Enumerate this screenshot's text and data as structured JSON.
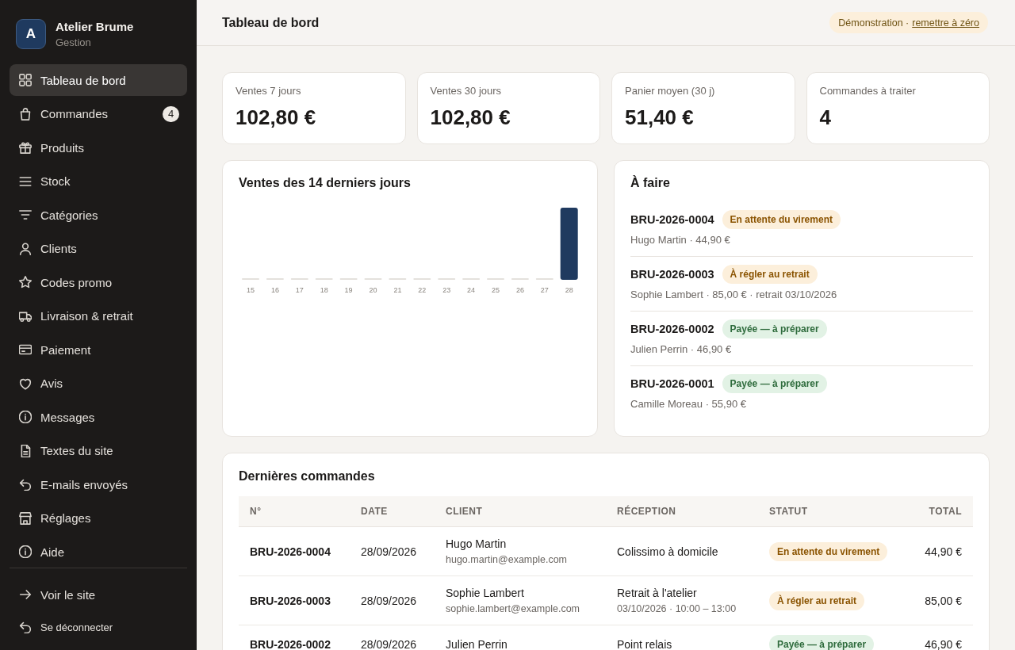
{
  "sidebar": {
    "brand": {
      "logo_letter": "A",
      "name": "Atelier Brume",
      "subtitle": "Gestion"
    },
    "items": [
      {
        "label": "Tableau de bord",
        "selected": true
      },
      {
        "label": "Commandes",
        "selected": false,
        "badge": "4"
      },
      {
        "label": "Produits",
        "selected": false
      },
      {
        "label": "Stock",
        "selected": false
      },
      {
        "label": "Catégories",
        "selected": false
      },
      {
        "label": "Clients",
        "selected": false
      },
      {
        "label": "Codes promo",
        "selected": false
      },
      {
        "label": "Livraison & retrait",
        "selected": false
      },
      {
        "label": "Paiement",
        "selected": false
      },
      {
        "label": "Avis",
        "selected": false
      },
      {
        "label": "Messages",
        "selected": false
      },
      {
        "label": "Textes du site",
        "selected": false
      },
      {
        "label": "E-mails envoyés",
        "selected": false
      },
      {
        "label": "Réglages",
        "selected": false
      },
      {
        "label": "Aide",
        "selected": false
      }
    ],
    "footer_items": [
      {
        "label": "Voir le site",
        "kind": "link"
      },
      {
        "label": "Se déconnecter",
        "kind": "button"
      }
    ]
  },
  "header": {
    "title": "Tableau de bord",
    "demo_notice": {
      "text": "Démonstration ·",
      "link": "remettre à zéro"
    }
  },
  "stats": [
    {
      "label": "Ventes 7 jours",
      "value": "102,80 €"
    },
    {
      "label": "Ventes 30 jours",
      "value": "102,80 €"
    },
    {
      "label": "Panier moyen (30 j)",
      "value": "51,40 €"
    },
    {
      "label": "Commandes à traiter",
      "value": "4"
    }
  ],
  "sales_chart": {
    "title": "Ventes des 14 derniers jours",
    "days": [
      {
        "label": "15",
        "kind": "empty"
      },
      {
        "label": "16",
        "kind": "empty"
      },
      {
        "label": "17",
        "kind": "empty"
      },
      {
        "label": "18",
        "kind": "empty"
      },
      {
        "label": "19",
        "kind": "empty"
      },
      {
        "label": "20",
        "kind": "empty"
      },
      {
        "label": "21",
        "kind": "empty"
      },
      {
        "label": "22",
        "kind": "empty"
      },
      {
        "label": "23",
        "kind": "empty"
      },
      {
        "label": "24",
        "kind": "empty"
      },
      {
        "label": "25",
        "kind": "empty"
      },
      {
        "label": "26",
        "kind": "empty"
      },
      {
        "label": "27",
        "kind": "empty"
      },
      {
        "label": "28",
        "kind": "sale"
      }
    ]
  },
  "todo": {
    "title": "À faire",
    "items": [
      {
        "order": "BRU-2026-0004",
        "status": {
          "label": "En attente du virement",
          "kind": "warning"
        },
        "summary": "Hugo Martin · 44,90 €"
      },
      {
        "order": "BRU-2026-0003",
        "status": {
          "label": "À régler au retrait",
          "kind": "warning"
        },
        "summary": "Sophie Lambert · 85,00 € · retrait 03/10/2026"
      },
      {
        "order": "BRU-2026-0002",
        "status": {
          "label": "Payée — à préparer",
          "kind": "success"
        },
        "summary": "Julien Perrin · 46,90 €"
      },
      {
        "order": "BRU-2026-0001",
        "status": {
          "label": "Payée — à préparer",
          "kind": "success"
        },
        "summary": "Camille Moreau · 55,90 €"
      }
    ]
  },
  "recent_orders": {
    "title": "Dernières commandes",
    "columns": [
      "N°",
      "DATE",
      "CLIENT",
      "RÉCEPTION",
      "STATUT",
      "TOTAL"
    ],
    "rows": [
      {
        "number": "BRU-2026-0004",
        "date": "28/09/2026",
        "client": "Hugo Martin",
        "email": "hugo.martin@example.com",
        "reception": "Colissimo à domicile",
        "status": {
          "label": "En attente du virement",
          "kind": "warning"
        },
        "total": "44,90 €"
      },
      {
        "number": "BRU-2026-0003",
        "date": "28/09/2026",
        "client": "Sophie Lambert",
        "email": "sophie.lambert@example.com",
        "reception": "Retrait à l'atelier",
        "reception_detail": "03/10/2026 · 10:00 – 13:00",
        "status": {
          "label": "À régler au retrait",
          "kind": "warning"
        },
        "total": "85,00 €"
      },
      {
        "number": "BRU-2026-0002",
        "date": "28/09/2026",
        "client": "Julien Perrin",
        "reception": "Point relais",
        "status": {
          "label": "Payée — à préparer",
          "kind": "success"
        },
        "total": "46,90 €"
      }
    ]
  }
}
